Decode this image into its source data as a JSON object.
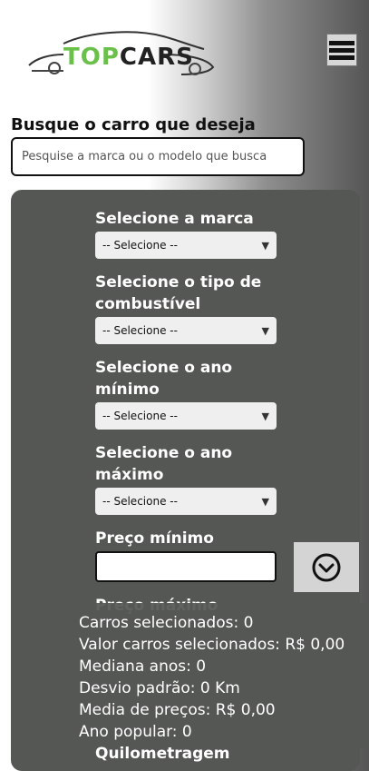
{
  "header": {
    "brand_top": "TOP",
    "brand_cars": "CARS",
    "menu_icon": "hamburger-icon"
  },
  "search": {
    "label": "Busque o carro que deseja",
    "placeholder": "Pesquise a marca ou o modelo que busca",
    "value": ""
  },
  "filters": {
    "marca": {
      "label": "Selecione a marca",
      "selected": "-- Selecione --"
    },
    "combustivel": {
      "label": "Selecione o tipo de combustível",
      "selected": "-- Selecione --"
    },
    "ano_min": {
      "label": "Selecione o ano mínimo",
      "selected": "-- Selecione --"
    },
    "ano_max": {
      "label": "Selecione o ano máximo",
      "selected": "-- Selecione --"
    },
    "preco_min": {
      "label": "Preço mínimo",
      "value": ""
    },
    "preco_max": {
      "label": "Preço máximo"
    },
    "km": {
      "label": "Quilometragem"
    }
  },
  "toggle": {
    "icon": "chevron-down-circle-icon"
  },
  "summary": {
    "carros": "Carros selecionados: 0",
    "valor": "Valor carros selecionados: R$ 0,00",
    "mediana": "Mediana anos: 0",
    "desvio": "Desvio padrão: 0 Km",
    "media": "Media de preços: R$ 0,00",
    "ano_popular": "Ano popular: 0"
  },
  "colors": {
    "brand_green": "#6bc04b",
    "panel": "#555754"
  }
}
